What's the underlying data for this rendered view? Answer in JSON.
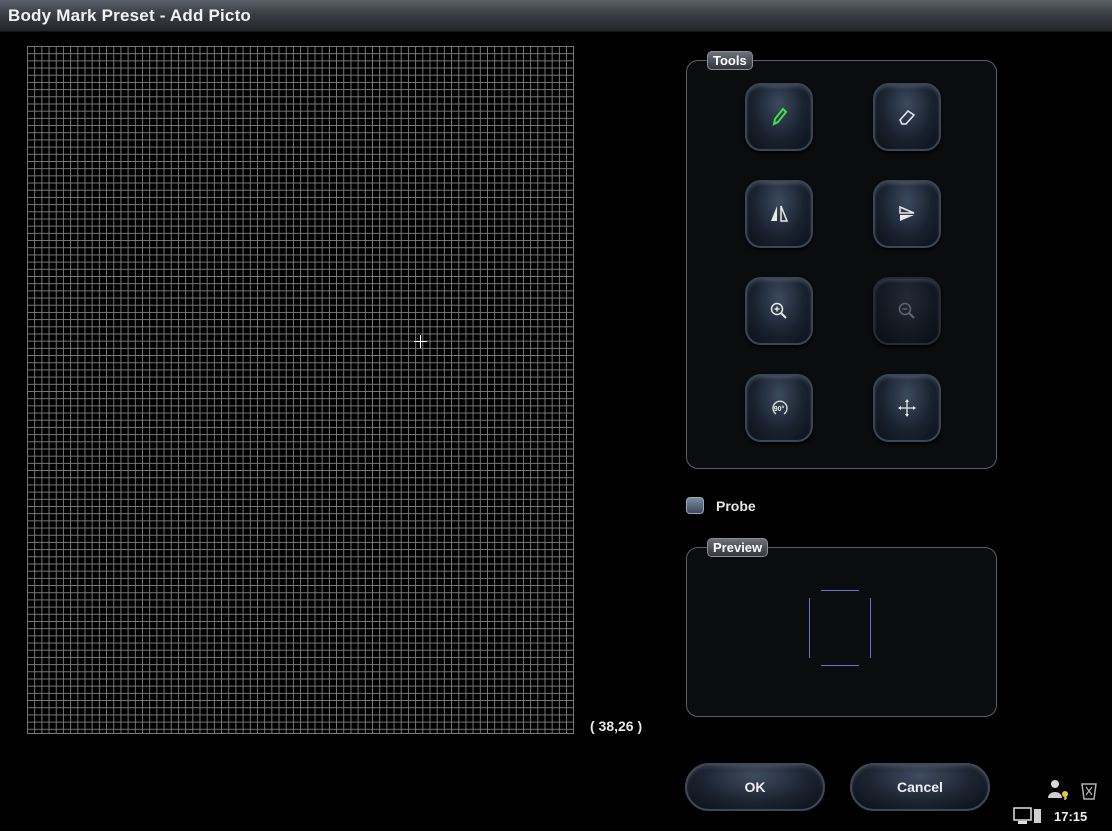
{
  "window": {
    "title": "Body Mark Preset - Add Picto"
  },
  "canvas": {
    "coordinates": "( 38,26 )"
  },
  "tools": {
    "label": "Tools",
    "buttons": [
      {
        "name": "pencil-icon",
        "active": true,
        "accent": "#3fe04a"
      },
      {
        "name": "eraser-icon"
      },
      {
        "name": "flip-horizontal-icon"
      },
      {
        "name": "flip-vertical-icon"
      },
      {
        "name": "zoom-in-icon"
      },
      {
        "name": "zoom-out-icon",
        "disabled": true
      },
      {
        "name": "rotate-90-icon",
        "text": "90°"
      },
      {
        "name": "move-icon"
      }
    ]
  },
  "probe": {
    "label": "Probe",
    "checked": false
  },
  "preview": {
    "label": "Preview",
    "probe_color": "#7070d0"
  },
  "actions": {
    "ok_label": "OK",
    "cancel_label": "Cancel"
  },
  "status": {
    "time": "17:15"
  }
}
